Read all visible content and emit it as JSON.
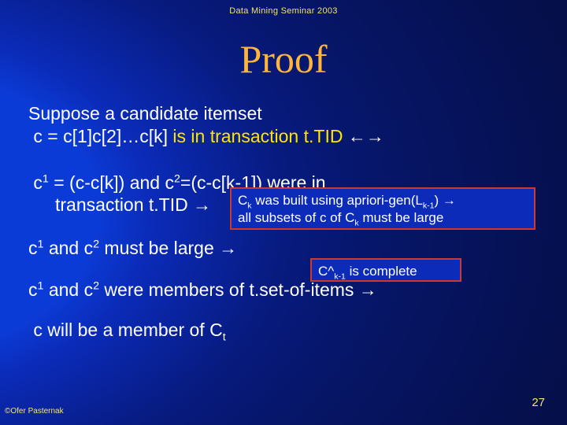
{
  "header": {
    "seminar": "Data Mining Seminar 2003"
  },
  "title": "Proof",
  "body": {
    "line1a": "Suppose a candidate itemset",
    "line1b_pre": "c = c[1]c[2]…c[k] ",
    "line1b_yellow": "is in transaction t.TID",
    "line1b_arrow": " ←→",
    "line2a_pre": "c",
    "line2a_sup1": "1",
    "line2a_mid": " = (c-c[k]) and c",
    "line2a_sup2": "2",
    "line2a_post": "=(c-c[k-1]) were in",
    "line2b": "transaction t.TID →",
    "line3_pre": "c",
    "line3_sup1": "1",
    "line3_mid": " and c",
    "line3_sup2": "2",
    "line3_post": " must be large →",
    "line4_pre": "c",
    "line4_sup1": "1",
    "line4_mid": " and c",
    "line4_sup2": "2",
    "line4_post": " were members of t.set-of-items →",
    "line5_pre": "c will be a member of C",
    "line5_sub": "t"
  },
  "box1": {
    "l1_pre": "C",
    "l1_sub": "k",
    "l1_mid": " was built using apriori-gen(L",
    "l1_sub2": "k-1",
    "l1_post": ") →",
    "l2_pre": "all subsets of c of C",
    "l2_sub": "k",
    "l2_post": " must be large"
  },
  "box2": {
    "pre": "C^",
    "sub": "k-1",
    "post": " is complete"
  },
  "footer": {
    "copyright": "©Ofer Pasternak",
    "page": "27"
  }
}
